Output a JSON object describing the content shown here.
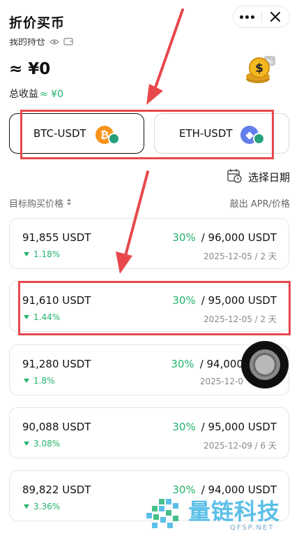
{
  "header": {
    "title": "折价买币"
  },
  "portfolio": {
    "holdings_label": "我的持仓",
    "balance": "≈ ¥0",
    "pnl_label": "总收益",
    "pnl_value": "≈ ¥0"
  },
  "tabs": [
    {
      "label": "BTC-USDT",
      "coin_glyph": "₿",
      "icon": "bitcoin-icon",
      "selected": true
    },
    {
      "label": "ETH-USDT",
      "coin_glyph": "◆",
      "icon": "ethereum-icon",
      "selected": false
    }
  ],
  "date_select": {
    "label": "选择日期",
    "icon": "calendar-icon"
  },
  "list_header": {
    "left": "目标购买价格",
    "right": "敲出 APR/价格"
  },
  "products": [
    {
      "price": "91,855 USDT",
      "change": "1.18%",
      "apr": "30%",
      "target": "/ 96,000 USDT",
      "expiry": "2025-12-05 / 2 天"
    },
    {
      "price": "91,610 USDT",
      "change": "1.44%",
      "apr": "30%",
      "target": "/ 95,000 USDT",
      "expiry": "2025-12-05 / 2 天"
    },
    {
      "price": "91,280 USDT",
      "change": "1.8%",
      "apr": "30%",
      "target": "/ 94,000",
      "expiry": "2025-12-0"
    },
    {
      "price": "90,088 USDT",
      "change": "3.08%",
      "apr": "30%",
      "target": "/ 95,000 USDT",
      "expiry": "2025-12-09 / 6 天"
    },
    {
      "price": "89,822 USDT",
      "change": "3.36%",
      "apr": "30%",
      "target": "/ 94,000 USDT",
      "expiry": ""
    }
  ],
  "watermark": {
    "name": "量链科技",
    "url": "QFSP.NET"
  },
  "colors": {
    "accent_green": "#21b36b",
    "annotation_red": "#e8484c",
    "btc_orange": "#f7931a",
    "eth_blue": "#627eea",
    "watermark_blue": "#5bbfe8"
  }
}
